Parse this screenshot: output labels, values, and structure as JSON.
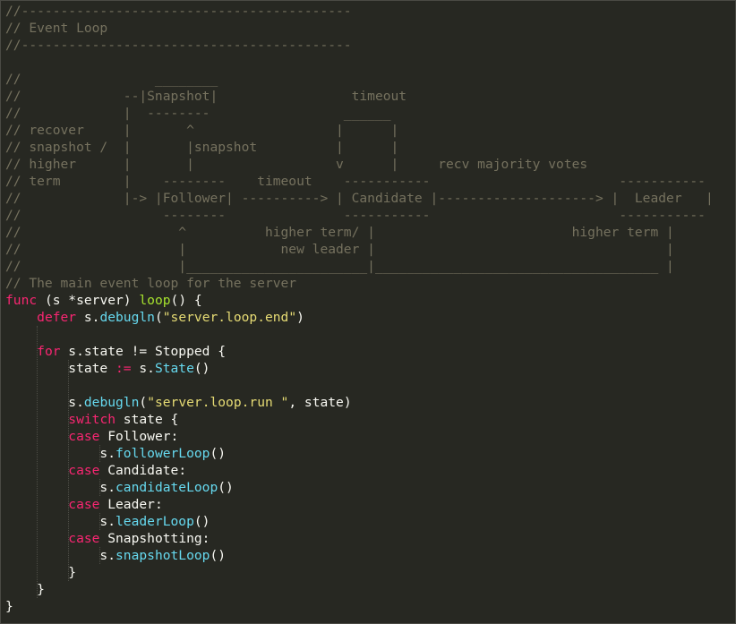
{
  "colors": {
    "background": "#272822",
    "comment": "#75715e",
    "keyword": "#f92672",
    "function": "#a6e22e",
    "call": "#66d9ef",
    "string": "#e6db74",
    "text": "#f8f8f2"
  },
  "lines": [
    [
      {
        "t": "comment",
        "v": "//------------------------------------------"
      }
    ],
    [
      {
        "t": "comment",
        "v": "// Event Loop"
      }
    ],
    [
      {
        "t": "comment",
        "v": "//------------------------------------------"
      }
    ],
    [],
    [
      {
        "t": "comment",
        "v": "//                 ________"
      }
    ],
    [
      {
        "t": "comment",
        "v": "//             --|Snapshot|                 timeout"
      }
    ],
    [
      {
        "t": "comment",
        "v": "//             |  --------                 ______"
      }
    ],
    [
      {
        "t": "comment",
        "v": "// recover     |       ^                  |      |"
      }
    ],
    [
      {
        "t": "comment",
        "v": "// snapshot /  |       |snapshot          |      |"
      }
    ],
    [
      {
        "t": "comment",
        "v": "// higher      |       |                  v      |     recv majority votes"
      }
    ],
    [
      {
        "t": "comment",
        "v": "// term        |    --------    timeout    -----------                        -----------"
      }
    ],
    [
      {
        "t": "comment",
        "v": "//             |-> |Follower| ----------> | Candidate |--------------------> |  Leader   |"
      }
    ],
    [
      {
        "t": "comment",
        "v": "//                  --------               -----------                        -----------"
      }
    ],
    [
      {
        "t": "comment",
        "v": "//                    ^          higher term/ |                         higher term |"
      }
    ],
    [
      {
        "t": "comment",
        "v": "//                    |            new leader |                                     |"
      }
    ],
    [
      {
        "t": "comment",
        "v": "//                    |_______________________|____________________________________ |"
      }
    ],
    [
      {
        "t": "comment",
        "v": "// The main event loop for the server"
      }
    ],
    [
      {
        "t": "keyword",
        "v": "func"
      },
      {
        "t": "plain",
        "v": " (s *server) "
      },
      {
        "t": "func",
        "v": "loop"
      },
      {
        "t": "plain",
        "v": "() {"
      }
    ],
    [
      {
        "t": "plain",
        "v": "    "
      },
      {
        "t": "keyword",
        "v": "defer"
      },
      {
        "t": "plain",
        "v": " s."
      },
      {
        "t": "call",
        "v": "debugln"
      },
      {
        "t": "plain",
        "v": "("
      },
      {
        "t": "string",
        "v": "\"server.loop.end\""
      },
      {
        "t": "plain",
        "v": ")"
      }
    ],
    [],
    [
      {
        "t": "plain",
        "v": "    "
      },
      {
        "t": "keyword",
        "v": "for"
      },
      {
        "t": "plain",
        "v": " s.state != Stopped {"
      }
    ],
    [
      {
        "t": "plain",
        "v": "        state "
      },
      {
        "t": "op",
        "v": ":="
      },
      {
        "t": "plain",
        "v": " s."
      },
      {
        "t": "call",
        "v": "State"
      },
      {
        "t": "plain",
        "v": "()"
      }
    ],
    [],
    [
      {
        "t": "plain",
        "v": "        s."
      },
      {
        "t": "call",
        "v": "debugln"
      },
      {
        "t": "plain",
        "v": "("
      },
      {
        "t": "string",
        "v": "\"server.loop.run \""
      },
      {
        "t": "plain",
        "v": ", state)"
      }
    ],
    [
      {
        "t": "plain",
        "v": "        "
      },
      {
        "t": "keyword",
        "v": "switch"
      },
      {
        "t": "plain",
        "v": " state {"
      }
    ],
    [
      {
        "t": "plain",
        "v": "        "
      },
      {
        "t": "keyword",
        "v": "case"
      },
      {
        "t": "plain",
        "v": " Follower:"
      }
    ],
    [
      {
        "t": "plain",
        "v": "            s."
      },
      {
        "t": "call",
        "v": "followerLoop"
      },
      {
        "t": "plain",
        "v": "()"
      }
    ],
    [
      {
        "t": "plain",
        "v": "        "
      },
      {
        "t": "keyword",
        "v": "case"
      },
      {
        "t": "plain",
        "v": " Candidate:"
      }
    ],
    [
      {
        "t": "plain",
        "v": "            s."
      },
      {
        "t": "call",
        "v": "candidateLoop"
      },
      {
        "t": "plain",
        "v": "()"
      }
    ],
    [
      {
        "t": "plain",
        "v": "        "
      },
      {
        "t": "keyword",
        "v": "case"
      },
      {
        "t": "plain",
        "v": " Leader:"
      }
    ],
    [
      {
        "t": "plain",
        "v": "            s."
      },
      {
        "t": "call",
        "v": "leaderLoop"
      },
      {
        "t": "plain",
        "v": "()"
      }
    ],
    [
      {
        "t": "plain",
        "v": "        "
      },
      {
        "t": "keyword",
        "v": "case"
      },
      {
        "t": "plain",
        "v": " Snapshotting:"
      }
    ],
    [
      {
        "t": "plain",
        "v": "            s."
      },
      {
        "t": "call",
        "v": "snapshotLoop"
      },
      {
        "t": "plain",
        "v": "()"
      }
    ],
    [
      {
        "t": "plain",
        "v": "        }"
      }
    ],
    [
      {
        "t": "plain",
        "v": "    }"
      }
    ],
    [
      {
        "t": "plain",
        "v": "}"
      }
    ]
  ]
}
